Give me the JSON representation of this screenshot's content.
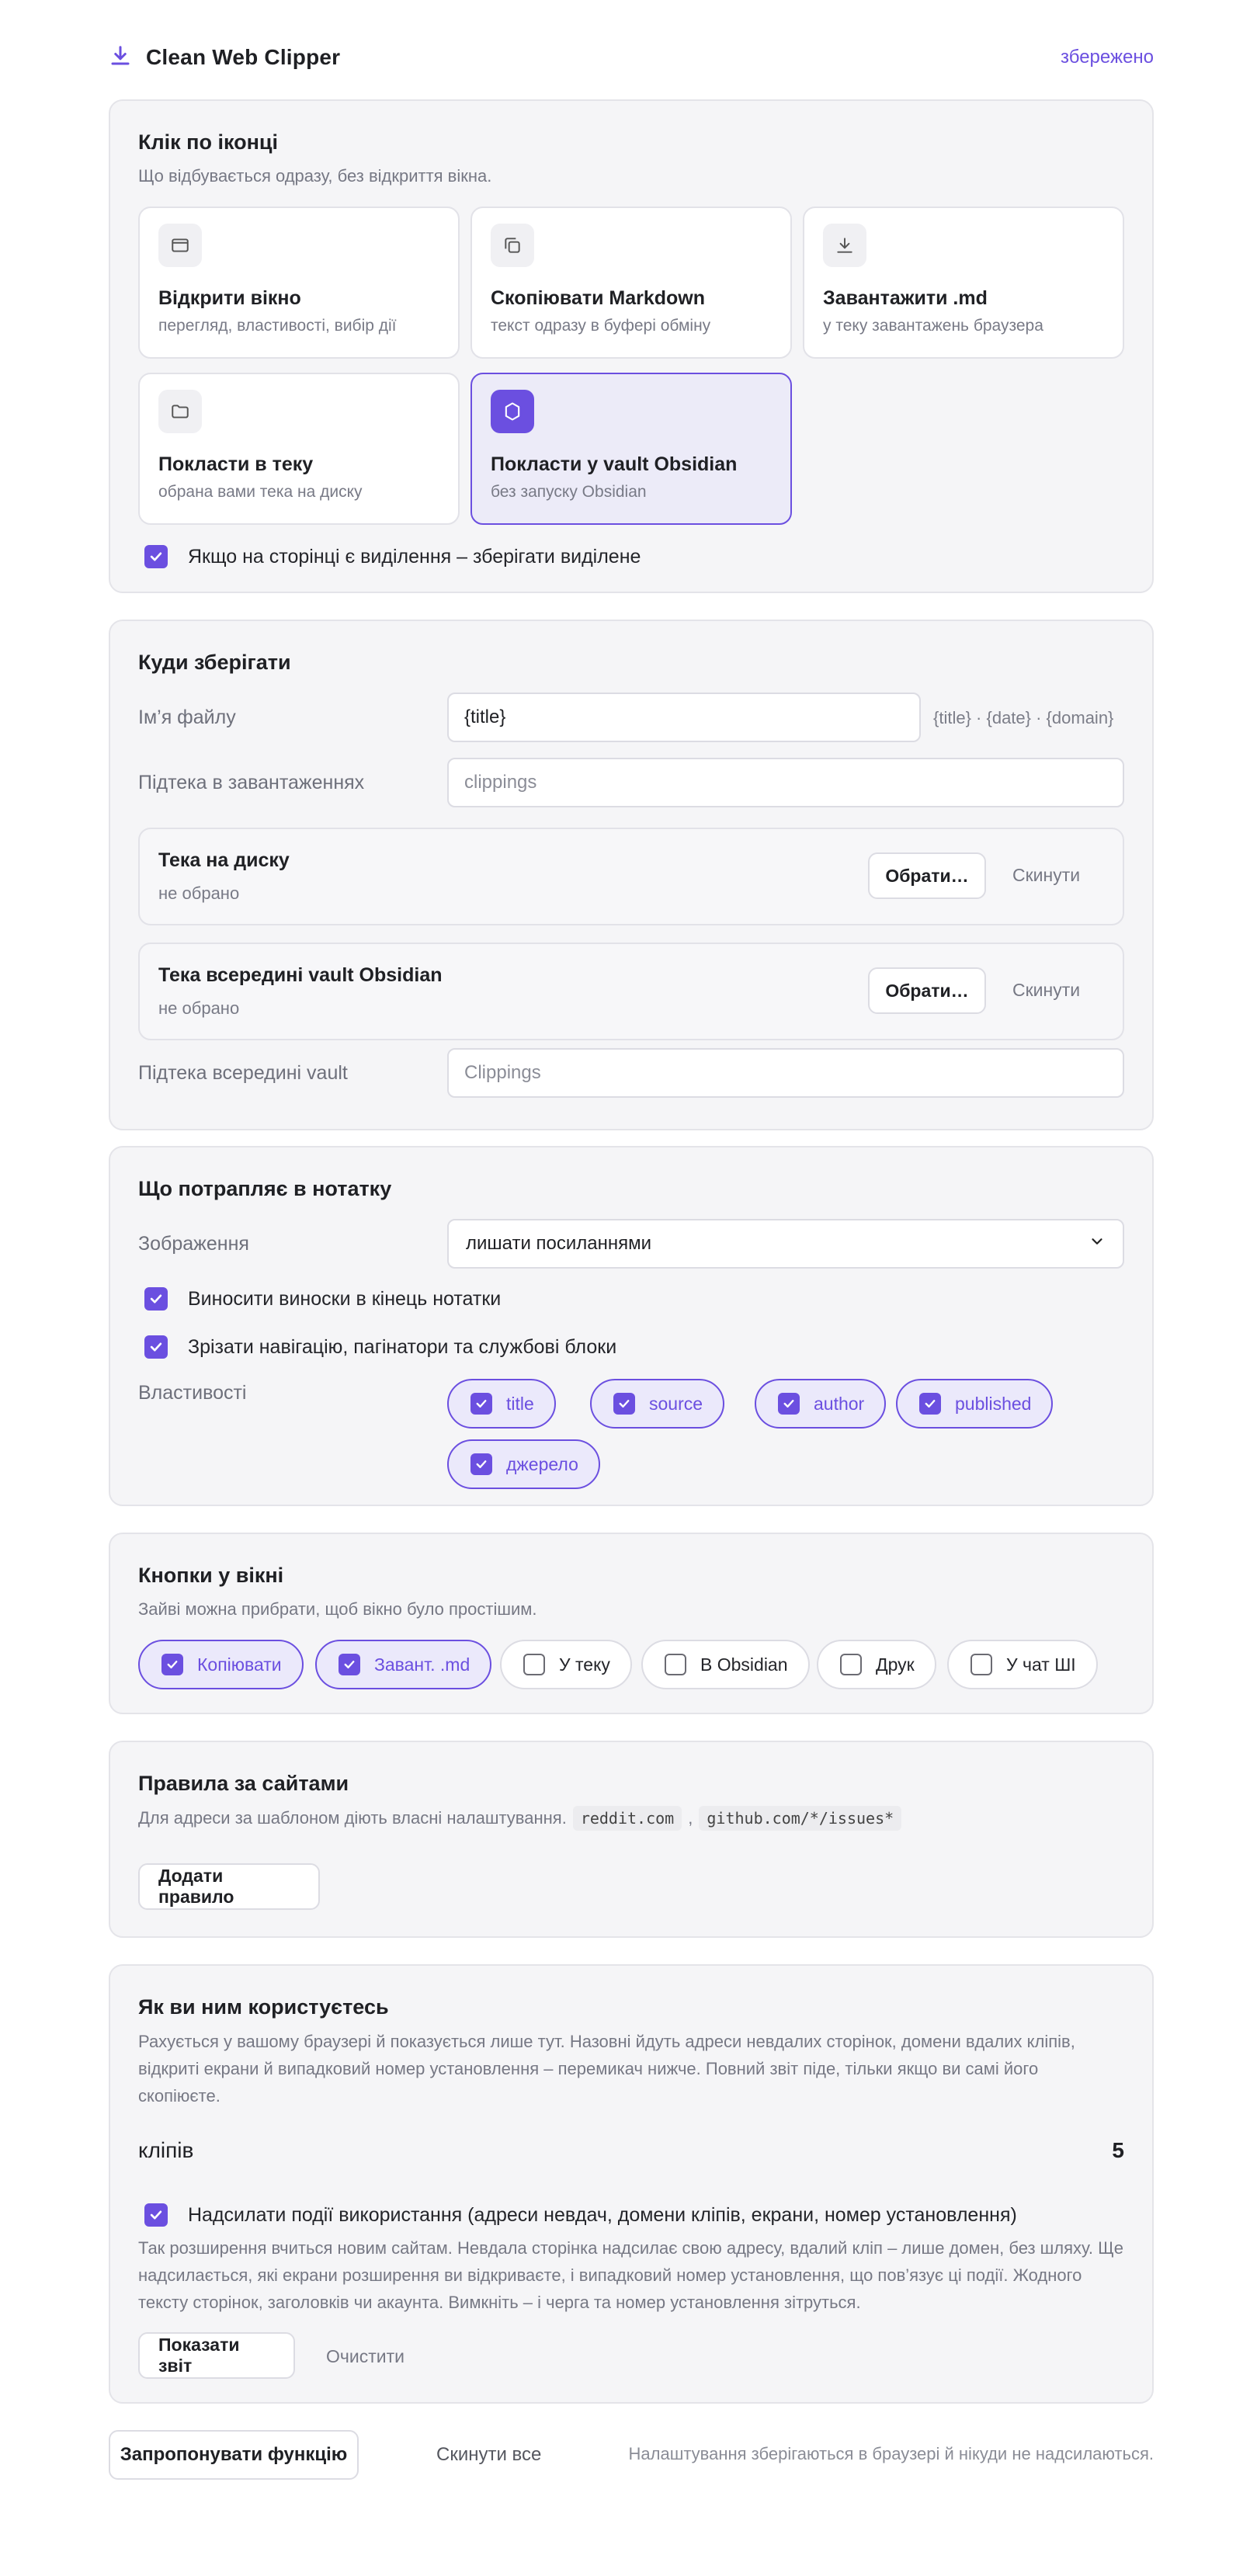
{
  "header": {
    "title": "Clean Web Clipper",
    "status": "збережено"
  },
  "click_section": {
    "title": "Клік по іконці",
    "subtitle": "Що відбувається одразу, без відкриття вікна.",
    "actions": [
      {
        "icon": "window-icon",
        "title": "Відкрити вікно",
        "desc": "перегляд, властивості, вибір дії",
        "selected": false
      },
      {
        "icon": "copy-icon",
        "title": "Скопіювати Markdown",
        "desc": "текст одразу в буфері обміну",
        "selected": false
      },
      {
        "icon": "download-icon",
        "title": "Завантажити .md",
        "desc": "у теку завантажень браузера",
        "selected": false
      },
      {
        "icon": "folder-icon",
        "title": "Покласти в теку",
        "desc": "обрана вами тека на диску",
        "selected": false
      },
      {
        "icon": "obsidian-icon",
        "title": "Покласти у vault Obsidian",
        "desc": "без запуску Obsidian",
        "selected": true
      }
    ],
    "selection_checkbox": {
      "label": "Якщо на сторінці є виділення – зберігати виділене",
      "checked": true
    }
  },
  "save_section": {
    "title": "Куди зберігати",
    "filename_label": "Ім’я файлу",
    "filename_value": "{title}",
    "filename_hint": "{title} · {date} · {domain}",
    "downloads_subfolder_label": "Підтека в завантаженнях",
    "downloads_subfolder_placeholder": "clippings",
    "disk_folder": {
      "title": "Тека на диску",
      "value": "не обрано",
      "choose": "Обрати…",
      "reset": "Скинути"
    },
    "vault_folder": {
      "title": "Тека всередині vault Obsidian",
      "value": "не обрано",
      "choose": "Обрати…",
      "reset": "Скинути"
    },
    "vault_subfolder_label": "Підтека всередині vault",
    "vault_subfolder_placeholder": "Clippings"
  },
  "note_section": {
    "title": "Що потрапляє в нотатку",
    "images_label": "Зображення",
    "images_value": "лишати посиланнями",
    "footnotes": {
      "label": "Виносити виноски в кінець нотатки",
      "checked": true
    },
    "cut_nav": {
      "label": "Зрізати навігацію, пагінатори та службові блоки",
      "checked": true
    },
    "properties_label": "Властивості",
    "properties": [
      {
        "label": "title",
        "checked": true
      },
      {
        "label": "source",
        "checked": true
      },
      {
        "label": "author",
        "checked": true
      },
      {
        "label": "published",
        "checked": true
      },
      {
        "label": "джерело",
        "checked": true
      }
    ]
  },
  "buttons_section": {
    "title": "Кнопки у вікні",
    "subtitle": "Зайві можна прибрати, щоб вікно було простішим.",
    "buttons": [
      {
        "label": "Копіювати",
        "checked": true
      },
      {
        "label": "Завант. .md",
        "checked": true
      },
      {
        "label": "У теку",
        "checked": false
      },
      {
        "label": "В Obsidian",
        "checked": false
      },
      {
        "label": "Друк",
        "checked": false
      },
      {
        "label": "У чат ШІ",
        "checked": false
      }
    ]
  },
  "rules_section": {
    "title": "Правила за сайтами",
    "subtitle": "Для адреси за шаблоном діють власні налаштування.",
    "example1": "reddit.com",
    "sep": ",",
    "example2": "github.com/*/issues*",
    "add_button": "Додати правило"
  },
  "usage_section": {
    "title": "Як ви ним користуєтесь",
    "description": "Рахується у вашому браузері й показується лише тут. Назовні йдуть адреси невдалих сторінок, домени вдалих кліпів, відкриті екрани й випадковий номер установлення – перемикач нижче. Повний звіт піде, тільки якщо ви самі його скопіюєте.",
    "stat_label": "кліпів",
    "stat_value": "5",
    "telemetry": {
      "label": "Надсилати події використання (адреси невдач, домени кліпів, екрани, номер установлення)",
      "checked": true
    },
    "telemetry_desc": "Так розширення вчиться новим сайтам. Невдала сторінка надсилає свою адресу, вдалий кліп – лише домен, без шляху. Ще надсилається, які екрани розширення ви відкриваєте, і випадковий номер установлення, що пов’язує ці події. Жодного тексту сторінок, заголовків чи акаунта. Вимкніть – і черга та номер установлення зітруться.",
    "show_report": "Показати звіт",
    "clear": "Очистити"
  },
  "footer": {
    "suggest": "Запропонувати функцію",
    "reset_all": "Скинути все",
    "note": "Налаштування зберігаються в браузері й нікуди не надсилаються."
  },
  "colors": {
    "accent": "#6b4fe0",
    "card_bg": "#f5f5f7",
    "muted": "#767884"
  }
}
